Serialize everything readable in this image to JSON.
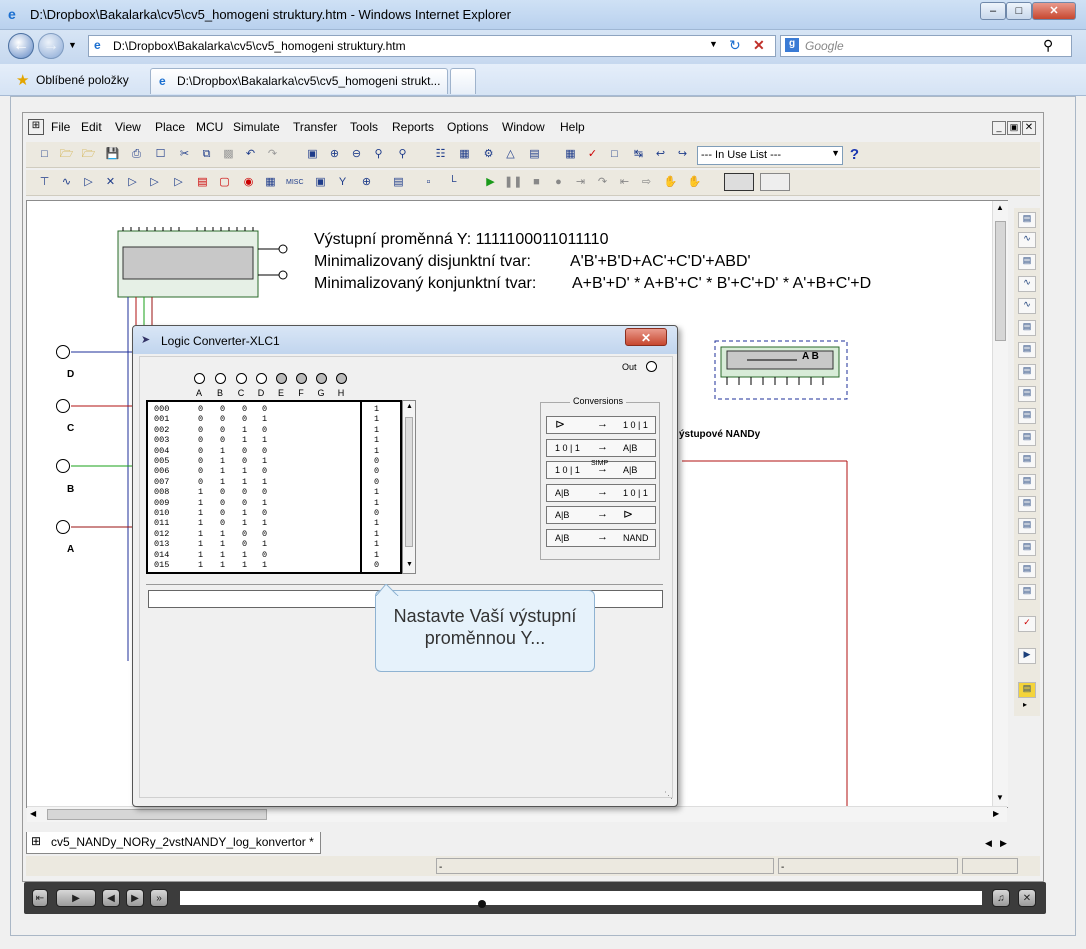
{
  "browser": {
    "window_title": "D:\\Dropbox\\Bakalarka\\cv5\\cv5_homogeni struktury.htm - Windows Internet Explorer",
    "address": "D:\\Dropbox\\Bakalarka\\cv5\\cv5_homogeni struktury.htm",
    "search_placeholder": "Google",
    "favorites_label": "Oblíbené položky",
    "tab_label": "D:\\Dropbox\\Bakalarka\\cv5\\cv5_homogeni strukt..."
  },
  "app": {
    "menu": [
      "File",
      "Edit",
      "View",
      "Place",
      "MCU",
      "Simulate",
      "Transfer",
      "Tools",
      "Reports",
      "Options",
      "Window",
      "Help"
    ],
    "in_use_list": "--- In Use List ---",
    "misc_label": "MISC",
    "document_tab": "cv5_NANDy_NORy_2vstNANDY_log_konvertor *",
    "status_dash_1": "-",
    "status_dash_2": "-"
  },
  "canvas": {
    "output_line": "Výstupní proměnná Y: 1111100011011110",
    "dnf_label": "Minimalizovaný disjunktní tvar:",
    "dnf_value": "A'B'+B'D+AC'+C'D'+ABD'",
    "knf_label": "Minimalizovaný konjunktní tvar:",
    "knf_value": "A+B'+D' * A+B'+C' * B'+C'+D' * A'+B+C'+D",
    "inputs": [
      "D",
      "C",
      "B",
      "A"
    ],
    "component_label": "A B",
    "partial_label": "ýstupové NANDy"
  },
  "dialog": {
    "title": "Logic Converter-XLC1",
    "out_label": "Out",
    "terminals": [
      "A",
      "B",
      "C",
      "D",
      "E",
      "F",
      "G",
      "H"
    ],
    "conversions_title": "Conversions",
    "conversions": [
      {
        "from": "gate-icon",
        "to": "1 0 | 1"
      },
      {
        "from": "1 0 | 1",
        "to": "A|B"
      },
      {
        "from": "1 0 | 1",
        "mid": "SIMP",
        "to": "A|B"
      },
      {
        "from": "A|B",
        "to": "1 0 | 1"
      },
      {
        "from": "A|B",
        "to": "gate-icon"
      },
      {
        "from": "A|B",
        "to": "NAND"
      }
    ],
    "truth_table": [
      {
        "n": "000",
        "a": "0",
        "b": "0",
        "c": "0",
        "d": "0",
        "y": "1"
      },
      {
        "n": "001",
        "a": "0",
        "b": "0",
        "c": "0",
        "d": "1",
        "y": "1"
      },
      {
        "n": "002",
        "a": "0",
        "b": "0",
        "c": "1",
        "d": "0",
        "y": "1"
      },
      {
        "n": "003",
        "a": "0",
        "b": "0",
        "c": "1",
        "d": "1",
        "y": "1"
      },
      {
        "n": "004",
        "a": "0",
        "b": "1",
        "c": "0",
        "d": "0",
        "y": "1"
      },
      {
        "n": "005",
        "a": "0",
        "b": "1",
        "c": "0",
        "d": "1",
        "y": "0"
      },
      {
        "n": "006",
        "a": "0",
        "b": "1",
        "c": "1",
        "d": "0",
        "y": "0"
      },
      {
        "n": "007",
        "a": "0",
        "b": "1",
        "c": "1",
        "d": "1",
        "y": "0"
      },
      {
        "n": "008",
        "a": "1",
        "b": "0",
        "c": "0",
        "d": "0",
        "y": "1"
      },
      {
        "n": "009",
        "a": "1",
        "b": "0",
        "c": "0",
        "d": "1",
        "y": "1"
      },
      {
        "n": "010",
        "a": "1",
        "b": "0",
        "c": "1",
        "d": "0",
        "y": "0"
      },
      {
        "n": "011",
        "a": "1",
        "b": "0",
        "c": "1",
        "d": "1",
        "y": "1"
      },
      {
        "n": "012",
        "a": "1",
        "b": "1",
        "c": "0",
        "d": "0",
        "y": "1"
      },
      {
        "n": "013",
        "a": "1",
        "b": "1",
        "c": "0",
        "d": "1",
        "y": "1"
      },
      {
        "n": "014",
        "a": "1",
        "b": "1",
        "c": "1",
        "d": "0",
        "y": "1"
      },
      {
        "n": "015",
        "a": "1",
        "b": "1",
        "c": "1",
        "d": "1",
        "y": "0"
      }
    ],
    "tooltip": "Nastavte Vaší výstupní proměnnou Y..."
  },
  "colors": {
    "wire_blue": "#1e2f9a",
    "wire_red": "#b01010",
    "wire_green": "#1aa01a",
    "wire_dark_red": "#9a1010"
  }
}
